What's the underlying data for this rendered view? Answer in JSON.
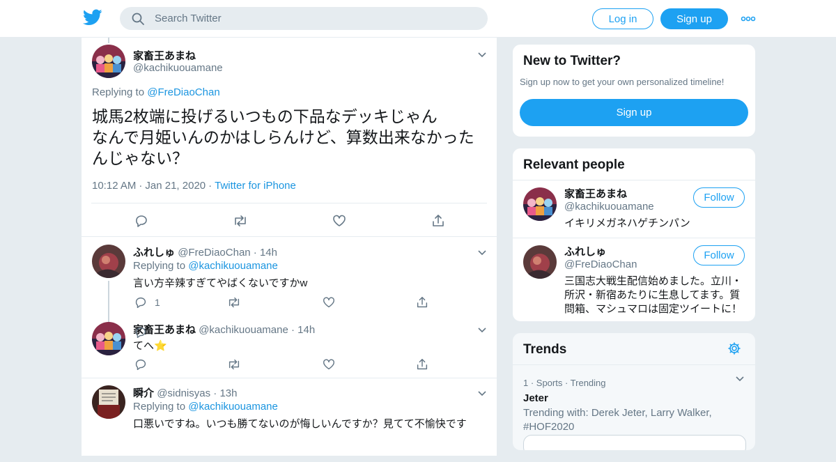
{
  "nav": {
    "search_placeholder": "Search Twitter",
    "login_label": "Log in",
    "signup_label": "Sign up"
  },
  "main_tweet": {
    "name": "家畜王あまね",
    "handle": "@kachikuouamane",
    "replying_prefix": "Replying to ",
    "replying_to": "@FreDiaoChan",
    "text": "城馬2枚端に投げるいつもの下品なデッキじゃん\nなんで月姫いんのかはしらんけど、算数出来なかったんじゃない？",
    "time": "10:12 AM",
    "date": "Jan 21, 2020",
    "source": "Twitter for iPhone"
  },
  "replies": [
    {
      "name": "ふれしゅ",
      "handle": "@FreDiaoChan",
      "time": "14h",
      "replying_prefix": "Replying to ",
      "replying_to": "@kachikuouamane",
      "text": "言い方辛辣すぎてやばくないですかw",
      "reply_count": "1"
    },
    {
      "name": "家畜王あまね",
      "handle": "@kachikuouamane",
      "time": "14h",
      "text": "てへ⭐"
    },
    {
      "name": "瞬介",
      "handle": "@sidnisyas",
      "time": "13h",
      "replying_prefix": "Replying to ",
      "replying_to": "@kachikuouamane",
      "text": "口悪いですね。いつも勝てないのが悔しいんですか？見てて不愉快です"
    }
  ],
  "sidebar": {
    "new_title": "New to Twitter?",
    "new_sub": "Sign up now to get your own personalized timeline!",
    "new_button": "Sign up",
    "relevant_title": "Relevant people",
    "people": [
      {
        "name": "家畜王あまね",
        "handle": "@kachikuouamane",
        "bio": "イキリメガネハゲチンパン",
        "follow_label": "Follow"
      },
      {
        "name": "ふれしゅ",
        "handle": "@FreDiaoChan",
        "bio": "三国志大戦生配信始めました。立川・所沢・新宿あたりに生息してます。質問箱、マシュマロは固定ツイートに！",
        "follow_label": "Follow"
      }
    ],
    "trends_title": "Trends",
    "trend": {
      "meta": "1 · Sports · Trending",
      "title": "Jeter",
      "sub": "Trending with: Derek Jeter, Larry Walker, #HOF2020"
    }
  },
  "colors": {
    "accent": "#1da1f2",
    "link": "#1b95e0",
    "muted": "#657786",
    "bg": "#e6ecf0"
  }
}
